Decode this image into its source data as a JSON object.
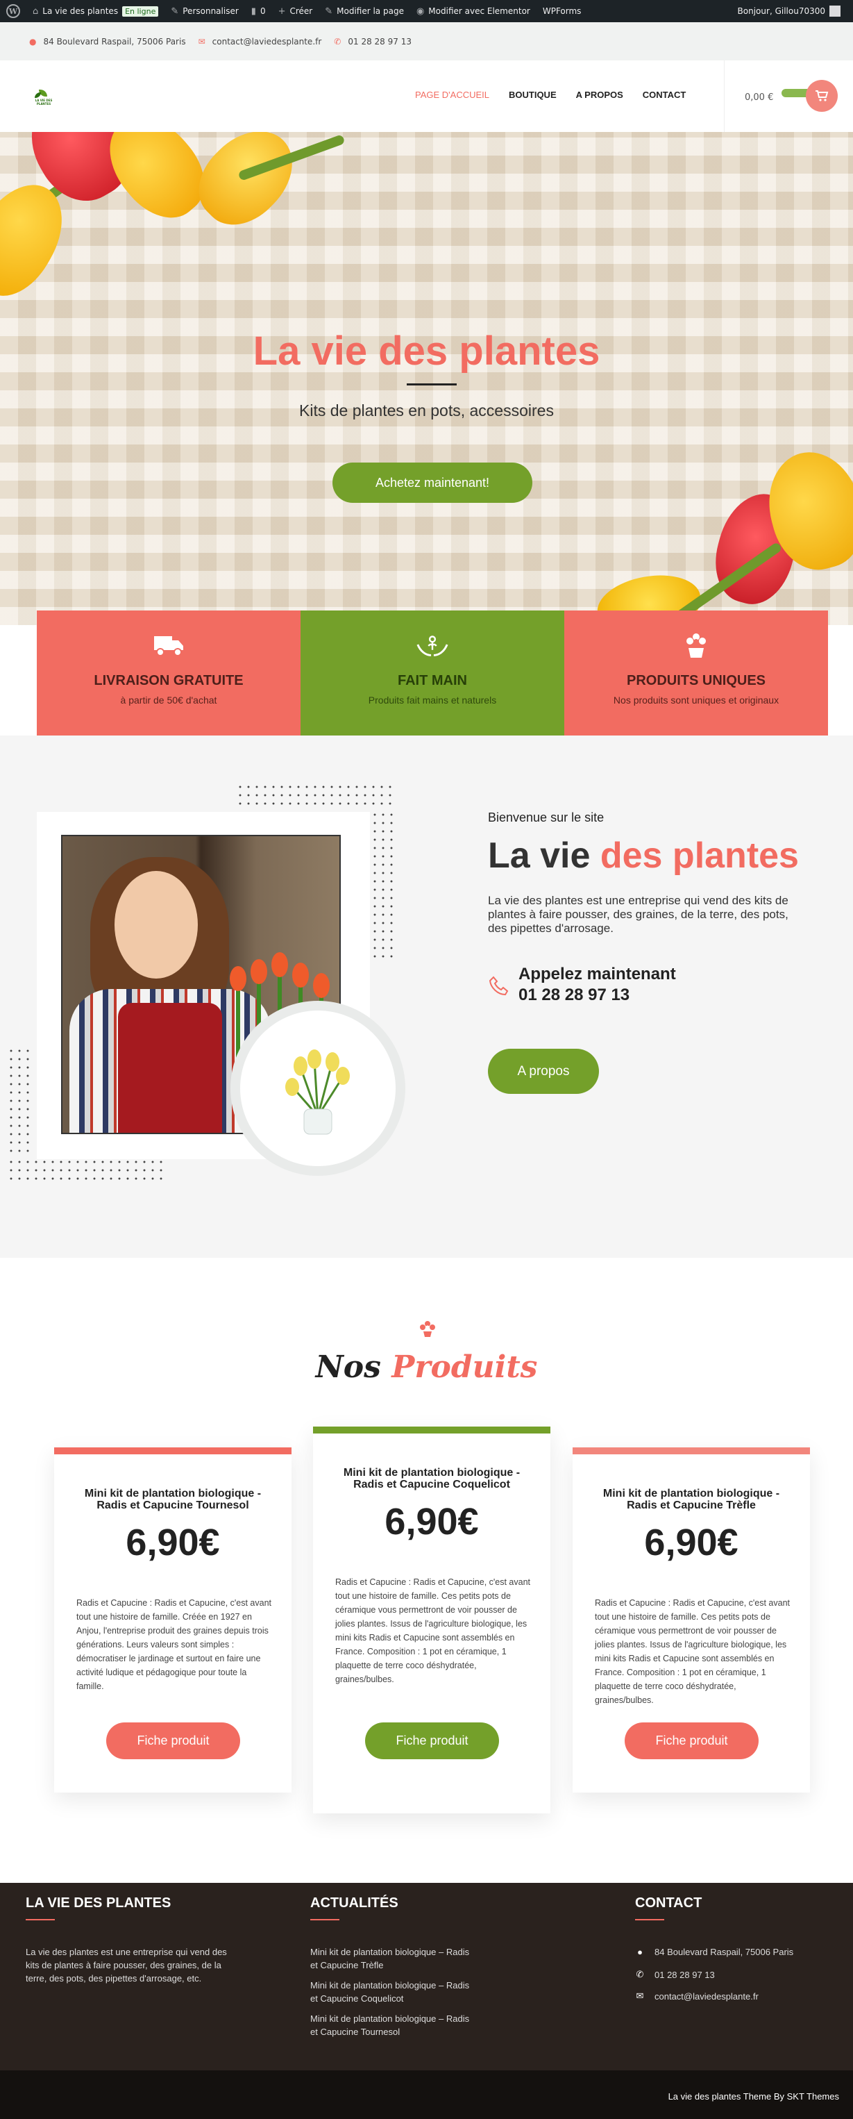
{
  "admin_bar": {
    "site_name": "La vie des plantes",
    "status_badge": "En ligne",
    "customize": "Personnaliser",
    "comments_count": "0",
    "new": "Créer",
    "edit_page": "Modifier la page",
    "elementor": "Modifier avec Elementor",
    "wpforms": "WPForms",
    "greeting": "Bonjour, Gillou70300"
  },
  "top_info": {
    "address": "84 Boulevard Raspail, 75006 Paris",
    "email": "contact@laviedesplante.fr",
    "phone": "01 28 28 97 13"
  },
  "header": {
    "logo_text": "LA VIE DES PLANTES",
    "nav": [
      "PAGE D'ACCUEIL",
      "BOUTIQUE",
      "A PROPOS",
      "CONTACT"
    ],
    "cart_total": "0,00 €"
  },
  "hero": {
    "title": "La vie des plantes",
    "subtitle": "Kits de plantes en pots, accessoires",
    "button": "Achetez maintenant!"
  },
  "features": [
    {
      "icon": "truck-icon",
      "title": "LIVRAISON GRATUITE",
      "subtitle": "à partir de 50€ d'achat",
      "color": "#f26c61"
    },
    {
      "icon": "hands-plant-icon",
      "title": "FAIT MAIN",
      "subtitle": "Produits fait mains et naturels",
      "color": "#74a02a"
    },
    {
      "icon": "flower-pot-icon",
      "title": "PRODUITS UNIQUES",
      "subtitle": "Nos produits sont uniques et originaux",
      "color": "#f26c61"
    }
  ],
  "about": {
    "eyebrow": "Bienvenue sur le site",
    "title_main": "La vie ",
    "title_accent": "des plantes",
    "text": "La vie des plantes est une entreprise qui vend des kits de plantes à faire pousser, des graines, de la terre, des pots, des pipettes d'arrosage.",
    "call_label": "Appelez maintenant",
    "call_number": "01 28 28 97 13",
    "button": "A propos"
  },
  "products": {
    "title_main": "Nos ",
    "title_accent": "Produits",
    "items": [
      {
        "name": "Mini kit de plantation biologique - Radis et Capucine Tournesol",
        "price": "6,90€",
        "description": "Radis et Capucine : Radis et Capucine, c'est avant tout une histoire de famille. Créée en 1927 en Anjou, l'entreprise produit des graines depuis trois générations. Leurs valeurs sont simples : démocratiser le jardinage et surtout en faire une activité ludique et pédagogique pour toute la famille.",
        "button": "Fiche produit",
        "accent": "#f26c61"
      },
      {
        "name": "Mini kit de plantation biologique - Radis et Capucine Coquelicot",
        "price": "6,90€",
        "description": "Radis et Capucine : Radis et Capucine, c'est avant tout une histoire de famille. Ces petits pots de céramique vous permettront de voir pousser de jolies plantes. Issus de l'agriculture biologique, les mini kits Radis et Capucine sont assemblés en France. Composition : 1 pot en céramique, 1 plaquette de terre coco déshydratée, graines/bulbes.",
        "button": "Fiche produit",
        "accent": "#74a02a"
      },
      {
        "name": "Mini kit de plantation biologique - Radis et Capucine Trèfle",
        "price": "6,90€",
        "description": "Radis et Capucine : Radis et Capucine, c'est avant tout une histoire de famille. Ces petits pots de céramique vous permettront de voir pousser de jolies plantes. Issus de l'agriculture biologique, les mini kits Radis et Capucine sont assemblés en France. Composition : 1 pot en céramique, 1 plaquette de terre coco déshydratée, graines/bulbes.",
        "button": "Fiche produit",
        "accent": "#f26c61"
      }
    ]
  },
  "footer": {
    "col1_title": "LA VIE DES PLANTES",
    "col1_text": "La vie des plantes est une entreprise qui vend des kits de plantes à faire pousser, des graines, de la terre, des pots, des pipettes d'arrosage, etc.",
    "col2_title": "ACTUALITÉS",
    "col2_links": [
      "Mini kit de plantation biologique – Radis et Capucine Trèfle",
      "Mini kit de plantation biologique – Radis et Capucine Coquelicot",
      "Mini kit de plantation biologique – Radis et Capucine Tournesol"
    ],
    "col3_title": "CONTACT",
    "address": "84 Boulevard Raspail, 75006 Paris",
    "phone": "01 28 28 97 13",
    "email": "contact@laviedesplante.fr",
    "copyright": "La vie des plantes Theme By SKT Themes"
  }
}
